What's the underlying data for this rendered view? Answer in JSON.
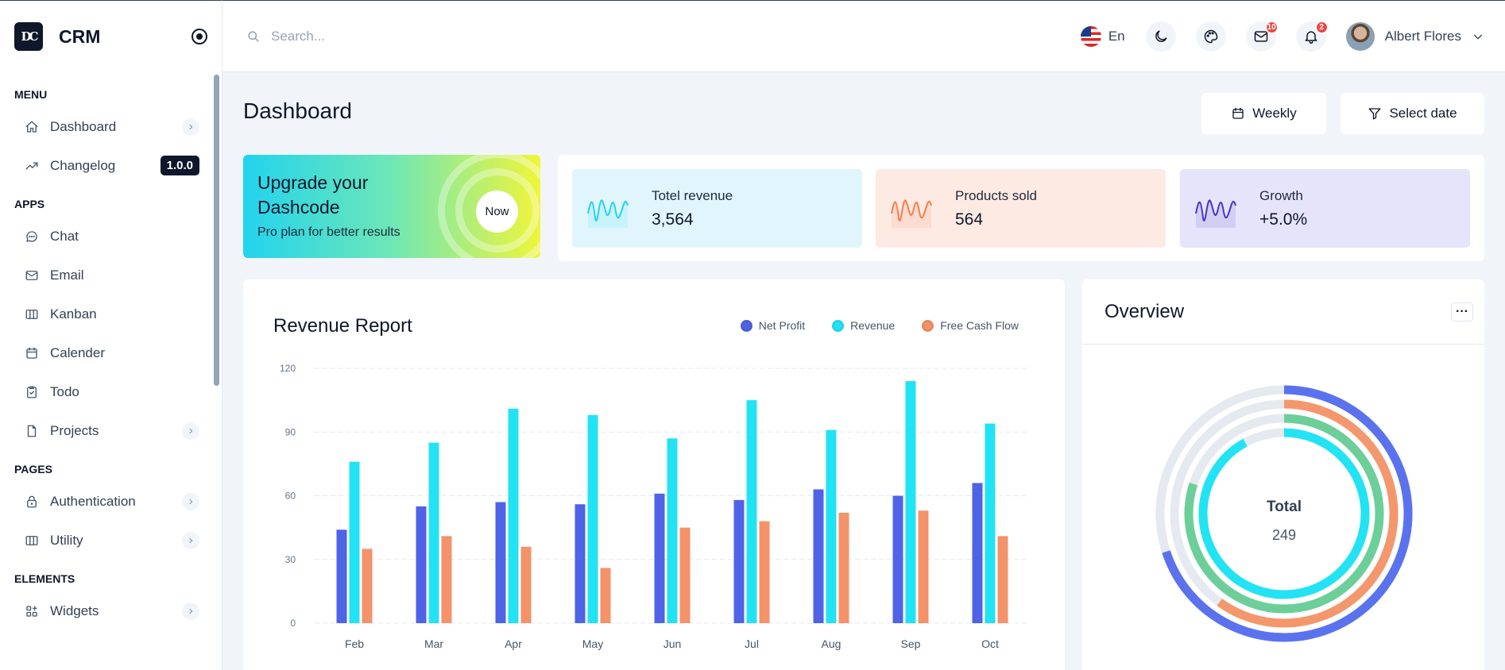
{
  "brand": {
    "logo_text": "DC",
    "name": "CRM"
  },
  "sidebar": {
    "sections": [
      {
        "title": "MENU",
        "items": [
          {
            "label": "Dashboard",
            "icon": "home-icon",
            "chevron": true
          },
          {
            "label": "Changelog",
            "icon": "trending-up-icon",
            "badge": "1.0.0"
          }
        ]
      },
      {
        "title": "APPS",
        "items": [
          {
            "label": "Chat",
            "icon": "chat-icon"
          },
          {
            "label": "Email",
            "icon": "mail-icon"
          },
          {
            "label": "Kanban",
            "icon": "kanban-icon"
          },
          {
            "label": "Calender",
            "icon": "calendar-icon"
          },
          {
            "label": "Todo",
            "icon": "clipboard-check-icon"
          },
          {
            "label": "Projects",
            "icon": "file-icon",
            "chevron": true
          }
        ]
      },
      {
        "title": "PAGES",
        "items": [
          {
            "label": "Authentication",
            "icon": "lock-icon",
            "chevron": true
          },
          {
            "label": "Utility",
            "icon": "columns-icon",
            "chevron": true
          }
        ]
      },
      {
        "title": "ELEMENTS",
        "items": [
          {
            "label": "Widgets",
            "icon": "widgets-icon",
            "chevron": true
          }
        ]
      }
    ]
  },
  "header": {
    "search_placeholder": "Search...",
    "language": "En",
    "mail_count": "10",
    "notification_count": "2",
    "user_name": "Albert Flores"
  },
  "page": {
    "title": "Dashboard",
    "weekly_label": "Weekly",
    "select_date_label": "Select date"
  },
  "upgrade": {
    "title": "Upgrade your Dashcode",
    "subtitle": "Pro plan for better results",
    "button": "Now"
  },
  "stats": [
    {
      "label": "Totel revenue",
      "value": "3,564",
      "bg": "#e0f6fc",
      "line": "#22d3ee"
    },
    {
      "label": "Products sold",
      "value": "564",
      "bg": "#fdeae3",
      "line": "#f97c4b"
    },
    {
      "label": "Growth",
      "value": "+5.0%",
      "bg": "#e6e4fb",
      "line": "#4338ca"
    }
  ],
  "revenue": {
    "title": "Revenue Report",
    "legend": [
      {
        "name": "Net Profit",
        "color": "#4f63e7"
      },
      {
        "name": "Revenue",
        "color": "#22e3f4"
      },
      {
        "name": "Free Cash Flow",
        "color": "#f4926a"
      }
    ]
  },
  "overview": {
    "title": "Overview",
    "total_label": "Total",
    "total_value": "249",
    "ring_colors": [
      "#5b72ee",
      "#f4976c",
      "#6ccf9a",
      "#22e3f4"
    ],
    "ring_values": [
      0.7,
      0.6,
      0.8,
      0.92
    ]
  },
  "chart_data": {
    "type": "bar",
    "categories": [
      "Feb",
      "Mar",
      "Apr",
      "May",
      "Jun",
      "Jul",
      "Aug",
      "Sep",
      "Oct"
    ],
    "series": [
      {
        "name": "Net Profit",
        "values": [
          44,
          55,
          57,
          56,
          61,
          58,
          63,
          60,
          66
        ]
      },
      {
        "name": "Revenue",
        "values": [
          76,
          85,
          101,
          98,
          87,
          105,
          91,
          114,
          94
        ]
      },
      {
        "name": "Free Cash Flow",
        "values": [
          35,
          41,
          36,
          26,
          45,
          48,
          52,
          53,
          41
        ]
      }
    ],
    "yticks": [
      "0",
      "30",
      "60",
      "90",
      "120"
    ],
    "ylim": [
      0,
      120
    ],
    "title": "Revenue Report",
    "xlabel": "",
    "ylabel": "",
    "grid": true,
    "legend_position": "top-right"
  }
}
